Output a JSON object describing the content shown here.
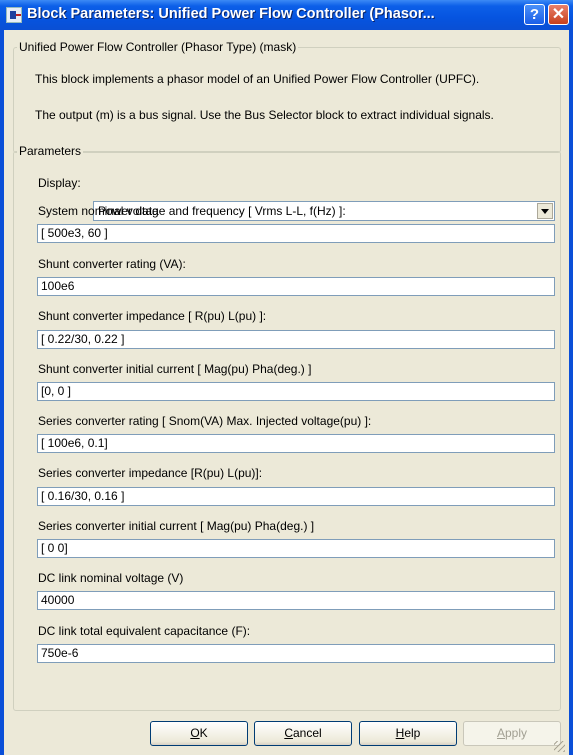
{
  "window": {
    "title": "Block Parameters: Unified Power Flow Controller (Phasor..."
  },
  "mask": {
    "group_label": "Unified Power Flow Controller (Phasor Type) (mask)",
    "description_1": "This block implements a phasor model of an Unified Power Flow Controller (UPFC).",
    "description_2": "The output (m) is a bus signal. Use the Bus Selector block to extract individual signals."
  },
  "parameters": {
    "group_label": "Parameters",
    "display_label": "Display:",
    "display_value": "Power data",
    "fields": [
      {
        "label": "System nominal voltage and frequency [ Vrms L-L, f(Hz) ]:",
        "value": "[ 500e3, 60 ]"
      },
      {
        "label": "Shunt converter rating (VA):",
        "value": "100e6"
      },
      {
        "label": "Shunt converter impedance [ R(pu)  L(pu) ]:",
        "value": "[ 0.22/30, 0.22 ]"
      },
      {
        "label": "Shunt converter initial current [ Mag(pu)  Pha(deg.) ]",
        "value": "[0, 0 ]"
      },
      {
        "label": "Series converter rating [ Snom(VA)   Max. Injected voltage(pu) ]:",
        "value": "[ 100e6, 0.1]"
      },
      {
        "label": "Series  converter impedance [R(pu)  L(pu)]:",
        "value": "[ 0.16/30, 0.16 ]"
      },
      {
        "label": "Series converter initial current [ Mag(pu)  Pha(deg.) ]",
        "value": "[ 0 0]"
      },
      {
        "label": "DC link nominal voltage (V)",
        "value": "40000"
      },
      {
        "label": "DC link total equivalent capacitance (F):",
        "value": "750e-6"
      }
    ]
  },
  "buttons": {
    "ok": {
      "hotkey": "O",
      "rest": "K"
    },
    "cancel": {
      "hotkey": "C",
      "rest": "ancel"
    },
    "help": {
      "hotkey": "H",
      "rest": "elp"
    },
    "apply": {
      "hotkey": "A",
      "rest": "pply"
    }
  },
  "icons": {
    "app": "simulink-block-icon",
    "help": "question-mark-icon",
    "close": "close-icon"
  }
}
